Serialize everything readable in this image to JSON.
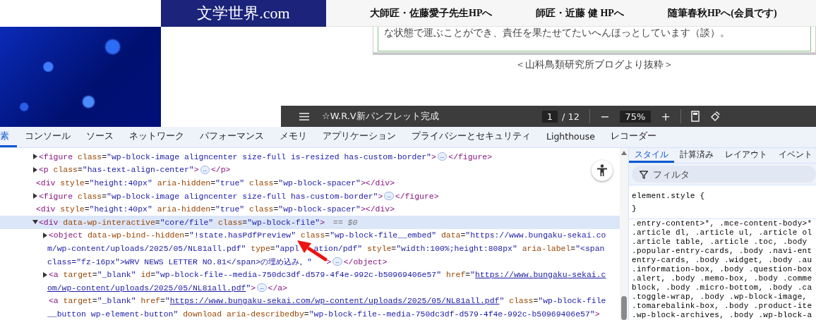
{
  "site": {
    "logo": "文学世界.com",
    "nav": [
      "大師匠・佐藤愛子先生HPへ",
      "師匠・近藤 健 HPへ",
      "随筆春秋HPへ(会員です)"
    ],
    "quote_text": "な状態で運ぶことができ、責任を果たせてたいへんほっとしています（談）。",
    "caption": "＜山科鳥類研究所ブログより抜粋＞"
  },
  "pdf_toolbar": {
    "title": "☆W.R.V新パンフレット完成",
    "page": "1",
    "page_count": "/ 12",
    "zoom_out": "−",
    "zoom": "75%",
    "zoom_in": "+"
  },
  "devtools": {
    "tabs": [
      {
        "label": "素",
        "selected": true
      },
      {
        "label": "コンソール",
        "selected": false
      },
      {
        "label": "ソース",
        "selected": false
      },
      {
        "label": "ネットワーク",
        "selected": false
      },
      {
        "label": "パフォーマンス",
        "selected": false
      },
      {
        "label": "メモリ",
        "selected": false
      },
      {
        "label": "アプリケーション",
        "selected": false
      },
      {
        "label": "プライバシーとセキュリティ",
        "selected": false
      },
      {
        "label": "Lighthouse",
        "selected": false
      },
      {
        "label": "レコーダー",
        "selected": false
      }
    ],
    "elements": {
      "nodes": [
        {
          "kind": "collapsed",
          "selected": false,
          "lines": [
            [
              {
                "kind": "tag",
                "text": "<figure"
              },
              {
                "kind": "attr",
                "text": " class"
              },
              {
                "kind": "txt",
                "text": "="
              },
              {
                "kind": "val",
                "text": "\"wp-block-image aligncenter size-full is-resized has-custom-border\""
              },
              {
                "kind": "tag",
                "text": ">"
              },
              {
                "kind": "ell",
                "text": "…"
              },
              {
                "kind": "tag",
                "text": "</figure>"
              }
            ]
          ]
        },
        {
          "kind": "collapsed",
          "selected": false,
          "lines": [
            [
              {
                "kind": "tag",
                "text": "<p"
              },
              {
                "kind": "attr",
                "text": " class"
              },
              {
                "kind": "txt",
                "text": "="
              },
              {
                "kind": "val",
                "text": "\"has-text-align-center\""
              },
              {
                "kind": "tag",
                "text": ">"
              },
              {
                "kind": "ell",
                "text": "…"
              },
              {
                "kind": "tag",
                "text": "</p>"
              }
            ]
          ]
        },
        {
          "kind": "leaf",
          "selected": false,
          "lines": [
            [
              {
                "kind": "tag",
                "text": "<div"
              },
              {
                "kind": "attr",
                "text": " style"
              },
              {
                "kind": "txt",
                "text": "="
              },
              {
                "kind": "val",
                "text": "\"height:40px\""
              },
              {
                "kind": "attr",
                "text": " aria-hidden"
              },
              {
                "kind": "txt",
                "text": "="
              },
              {
                "kind": "val",
                "text": "\"true\""
              },
              {
                "kind": "attr",
                "text": " class"
              },
              {
                "kind": "txt",
                "text": "="
              },
              {
                "kind": "val",
                "text": "\"wp-block-spacer\""
              },
              {
                "kind": "tag",
                "text": "></div>"
              }
            ]
          ]
        },
        {
          "kind": "collapsed",
          "selected": false,
          "lines": [
            [
              {
                "kind": "tag",
                "text": "<figure"
              },
              {
                "kind": "attr",
                "text": " class"
              },
              {
                "kind": "txt",
                "text": "="
              },
              {
                "kind": "val",
                "text": "\"wp-block-image aligncenter size-full has-custom-border\""
              },
              {
                "kind": "tag",
                "text": ">"
              },
              {
                "kind": "ell",
                "text": "…"
              },
              {
                "kind": "tag",
                "text": "</figure>"
              }
            ]
          ]
        },
        {
          "kind": "leaf",
          "selected": false,
          "lines": [
            [
              {
                "kind": "tag",
                "text": "<div"
              },
              {
                "kind": "attr",
                "text": " style"
              },
              {
                "kind": "txt",
                "text": "="
              },
              {
                "kind": "val",
                "text": "\"height:40px\""
              },
              {
                "kind": "attr",
                "text": " aria-hidden"
              },
              {
                "kind": "txt",
                "text": "="
              },
              {
                "kind": "val",
                "text": "\"true\""
              },
              {
                "kind": "attr",
                "text": " class"
              },
              {
                "kind": "txt",
                "text": "="
              },
              {
                "kind": "val",
                "text": "\"wp-block-spacer\""
              },
              {
                "kind": "tag",
                "text": "></div>"
              }
            ]
          ]
        },
        {
          "kind": "expanded",
          "selected": true,
          "lines": [
            [
              {
                "kind": "tag",
                "text": "<div"
              },
              {
                "kind": "attr",
                "text": " data-wp-interactive"
              },
              {
                "kind": "txt",
                "text": "="
              },
              {
                "kind": "val",
                "text": "\"core/file\""
              },
              {
                "kind": "attr",
                "text": " class"
              },
              {
                "kind": "txt",
                "text": "="
              },
              {
                "kind": "val",
                "text": "\"wp-block-file\""
              },
              {
                "kind": "tag",
                "text": ">"
              },
              {
                "kind": "ref",
                "text": "== $0"
              }
            ]
          ],
          "children": [
            {
              "kind": "collapsed",
              "selected": false,
              "lines": [
                [
                  {
                    "kind": "tag",
                    "text": "<object"
                  },
                  {
                    "kind": "attr",
                    "text": " data-wp-bind--hidden"
                  },
                  {
                    "kind": "txt",
                    "text": "="
                  },
                  {
                    "kind": "val",
                    "text": "\"!state.hasPdfPreview\""
                  },
                  {
                    "kind": "attr",
                    "text": " class"
                  },
                  {
                    "kind": "txt",
                    "text": "="
                  },
                  {
                    "kind": "val",
                    "text": "\"wp-block-file__embed\""
                  },
                  {
                    "kind": "attr",
                    "text": " data"
                  },
                  {
                    "kind": "txt",
                    "text": "="
                  },
                  {
                    "kind": "val",
                    "text": "\"https://www.bungaku-sekai.co"
                  }
                ],
                [
                  {
                    "kind": "val",
                    "text": "m/wp-content/uploads/2025/05/NL81all.pdf\""
                  },
                  {
                    "kind": "attr",
                    "text": " type"
                  },
                  {
                    "kind": "txt",
                    "text": "="
                  },
                  {
                    "kind": "val",
                    "text": "\"appl"
                  },
                  {
                    "kind": "hidden"
                  },
                  {
                    "kind": "val",
                    "text": "ation/pdf\""
                  },
                  {
                    "kind": "attr",
                    "text": " style"
                  },
                  {
                    "kind": "txt",
                    "text": "="
                  },
                  {
                    "kind": "val",
                    "text": "\"width:100%;height:808px\""
                  },
                  {
                    "kind": "attr",
                    "text": " aria-label"
                  },
                  {
                    "kind": "txt",
                    "text": "="
                  },
                  {
                    "kind": "val",
                    "text": "\"<span"
                  }
                ],
                [
                  {
                    "kind": "val",
                    "text": "class=\"fz-16px\">WRV NEWS LETTER NO.81</span>の埋め込み。\""
                  },
                  {
                    "kind": "hidden"
                  },
                  {
                    "kind": "tag",
                    "text": ">"
                  },
                  {
                    "kind": "ell",
                    "text": "…"
                  },
                  {
                    "kind": "tag",
                    "text": "</object>"
                  }
                ]
              ]
            },
            {
              "kind": "collapsed",
              "selected": false,
              "lines": [
                [
                  {
                    "kind": "tag",
                    "text": "<a"
                  },
                  {
                    "kind": "attr",
                    "text": " target"
                  },
                  {
                    "kind": "txt",
                    "text": "="
                  },
                  {
                    "kind": "val",
                    "text": "\"_blank\""
                  },
                  {
                    "kind": "attr",
                    "text": " id"
                  },
                  {
                    "kind": "txt",
                    "text": "="
                  },
                  {
                    "kind": "val",
                    "text": "\"wp-block-file--media-750dc3df-d579-4f4e-992c-b50969406e57\""
                  },
                  {
                    "kind": "attr",
                    "text": " href"
                  },
                  {
                    "kind": "txt",
                    "text": "="
                  },
                  {
                    "kind": "val",
                    "text": "\""
                  },
                  {
                    "kind": "link",
                    "text": "https://www.bungaku-sekai.c"
                  }
                ],
                [
                  {
                    "kind": "link",
                    "text": "om/wp-content/uploads/2025/05/NL81all.pdf"
                  },
                  {
                    "kind": "val",
                    "text": "\""
                  },
                  {
                    "kind": "tag",
                    "text": ">"
                  },
                  {
                    "kind": "ell",
                    "text": "…"
                  },
                  {
                    "kind": "tag",
                    "text": "</a>"
                  }
                ]
              ]
            },
            {
              "kind": "leaf",
              "selected": false,
              "lines": [
                [
                  {
                    "kind": "tag",
                    "text": "<a"
                  },
                  {
                    "kind": "attr",
                    "text": " target"
                  },
                  {
                    "kind": "txt",
                    "text": "="
                  },
                  {
                    "kind": "val",
                    "text": "\"_blank\""
                  },
                  {
                    "kind": "attr",
                    "text": " href"
                  },
                  {
                    "kind": "txt",
                    "text": "="
                  },
                  {
                    "kind": "val",
                    "text": "\""
                  },
                  {
                    "kind": "link",
                    "text": "https://www.bungaku-sekai.com/wp-content/uploads/2025/05/NL81all.pdf"
                  },
                  {
                    "kind": "val",
                    "text": "\""
                  },
                  {
                    "kind": "attr",
                    "text": " class"
                  },
                  {
                    "kind": "txt",
                    "text": "="
                  },
                  {
                    "kind": "val",
                    "text": "\"wp-block-file"
                  }
                ],
                [
                  {
                    "kind": "val",
                    "text": "__button wp-element-button\""
                  },
                  {
                    "kind": "attr",
                    "text": " download"
                  },
                  {
                    "kind": "attr",
                    "text": " aria-describedby"
                  },
                  {
                    "kind": "txt",
                    "text": "="
                  },
                  {
                    "kind": "val",
                    "text": "\"wp-block-file--media-750dc3df-d579-4f4e-992c-b50969406e57\""
                  },
                  {
                    "kind": "tag",
                    "text": ">"
                  }
                ]
              ]
            }
          ]
        }
      ]
    },
    "styles": {
      "tabs": [
        {
          "label": "スタイル",
          "selected": true
        },
        {
          "label": "計算済み",
          "selected": false
        },
        {
          "label": "レイアウト",
          "selected": false
        },
        {
          "label": "イベント",
          "selected": false
        }
      ],
      "filter_placeholder": "フィルタ",
      "element_style": [
        "element.style {",
        "}"
      ],
      "rules": [
        ".entry-content>*, .mce-content-body>*",
        ".article dl, .article ul, .article ol",
        ".article table, .article .toc, .body",
        ".popular-entry-cards, .body .navi-ent",
        "entry-cards, .body .widget, .body .au",
        ".information-box, .body .question-box",
        ".alert, .body .memo-box, .body .comme",
        "block, .body .micro-bottom, .body .ca",
        ".toggle-wrap, .body .wp-block-image,",
        ".tomarebalink-box, .body .product-ite",
        ".wp-block-archives, .body .wp-block-a"
      ]
    }
  }
}
